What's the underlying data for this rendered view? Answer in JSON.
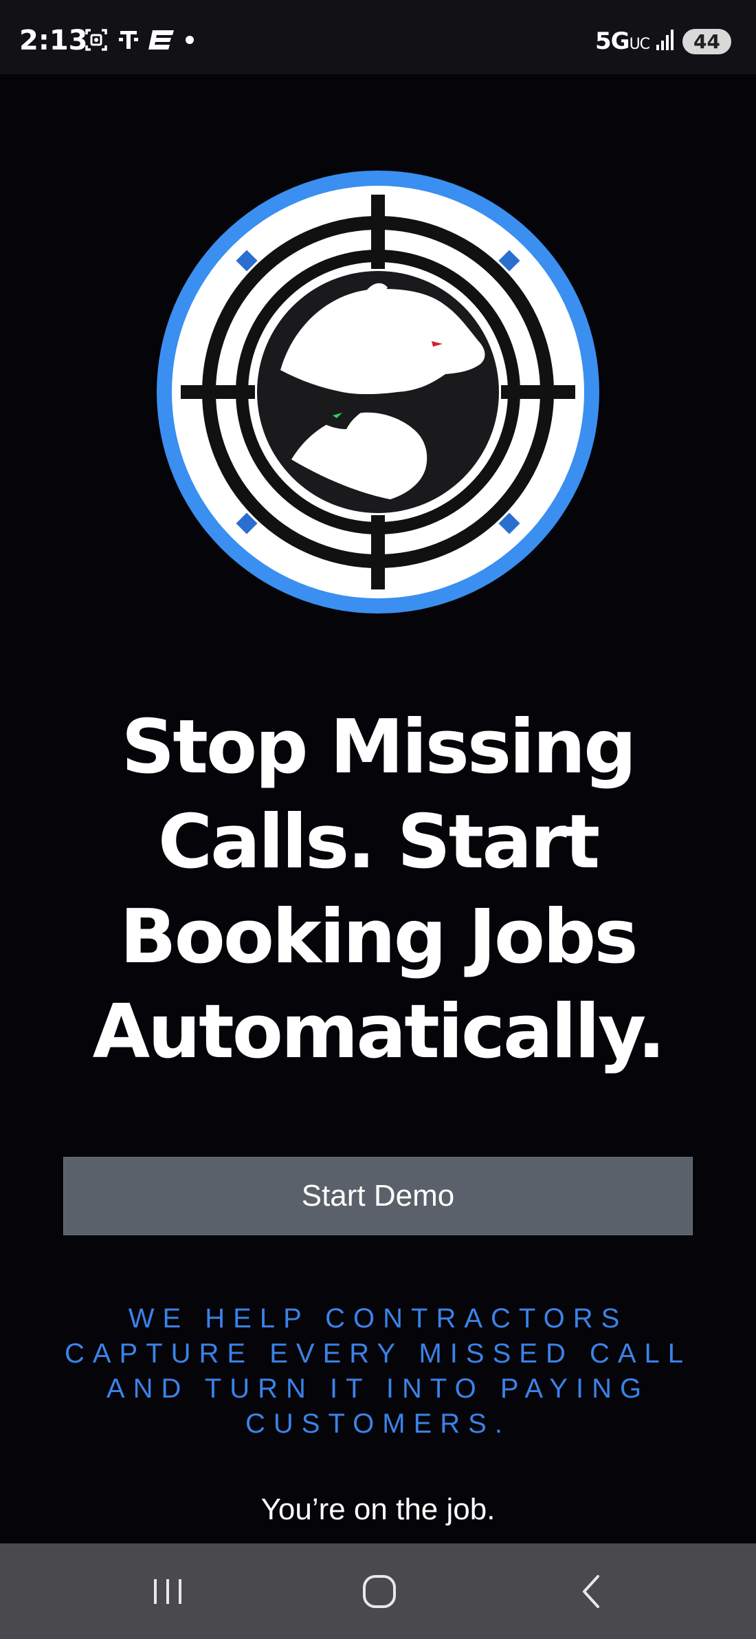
{
  "status_bar": {
    "time": "2:13",
    "left_icons": [
      "screenshot-icon",
      "t-mobile-icon",
      "espn-icon",
      "dot-icon"
    ],
    "network": "5G",
    "network_sub": "UC",
    "battery": "44"
  },
  "logo": {
    "description_icon": "crosshair-bear-bull-logo",
    "ring_color": "#3a8ff0",
    "diamond_color": "#2a6fd0"
  },
  "headline": {
    "line1": "Stop Missing",
    "line2": "Calls. Start",
    "line3": "Booking Jobs",
    "line4": "Automatically."
  },
  "cta": {
    "label": "Start Demo"
  },
  "tagline": {
    "text": "We help contractors capture every missed call and turn it into paying customers.",
    "color": "#3b82e8"
  },
  "subline": {
    "text": "You’re on the job."
  },
  "nav_bar": {
    "buttons": [
      "recent-apps-icon",
      "home-icon",
      "back-icon"
    ]
  }
}
